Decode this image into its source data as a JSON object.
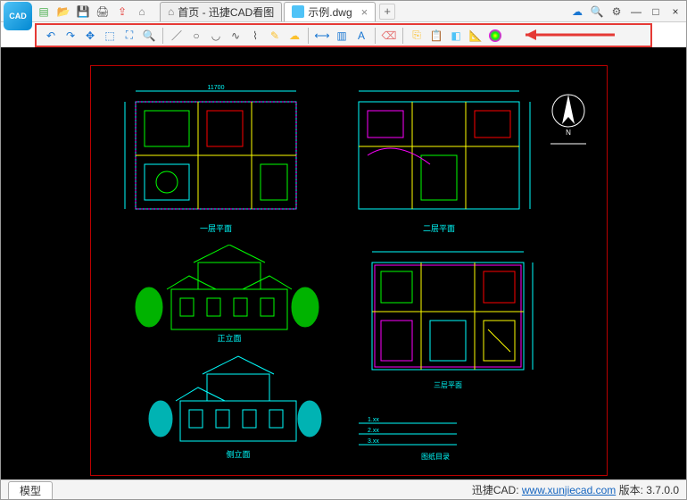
{
  "app": {
    "logo_text": "CAD"
  },
  "menubar": {
    "icons": [
      "new-file",
      "open-folder",
      "save",
      "print",
      "export",
      "home"
    ],
    "window_icons": [
      "cloud",
      "zoom",
      "settings",
      "minimize",
      "maximize",
      "close"
    ]
  },
  "tabs": {
    "home": {
      "label": "首页 - 迅捷CAD看图"
    },
    "doc": {
      "label": "示例.dwg"
    },
    "close": "×",
    "add": "+"
  },
  "toolbar": {
    "groups": [
      [
        "undo",
        "redo",
        "pan",
        "zoom-window",
        "zoom-extents",
        "zoom-in"
      ],
      [
        "line",
        "circle",
        "arc",
        "spline",
        "polyline",
        "edit",
        "erase"
      ],
      [
        "dimension",
        "layer",
        "text"
      ],
      [
        "eraser"
      ],
      [
        "copy",
        "paste",
        "3d",
        "measure",
        "color-wheel"
      ]
    ]
  },
  "drawing": {
    "labels": {
      "plan1": "一层平面",
      "plan2": "二层平面",
      "elev1": "正立面",
      "elev2": "侧立面",
      "schedule_title": "图纸目录",
      "dim_sample": "11700"
    }
  },
  "statusbar": {
    "model": "模型",
    "brand": "迅捷CAD:",
    "url_text": "www.xunjiecad.com",
    "version_label": "版本:",
    "version": "3.7.0.0"
  }
}
